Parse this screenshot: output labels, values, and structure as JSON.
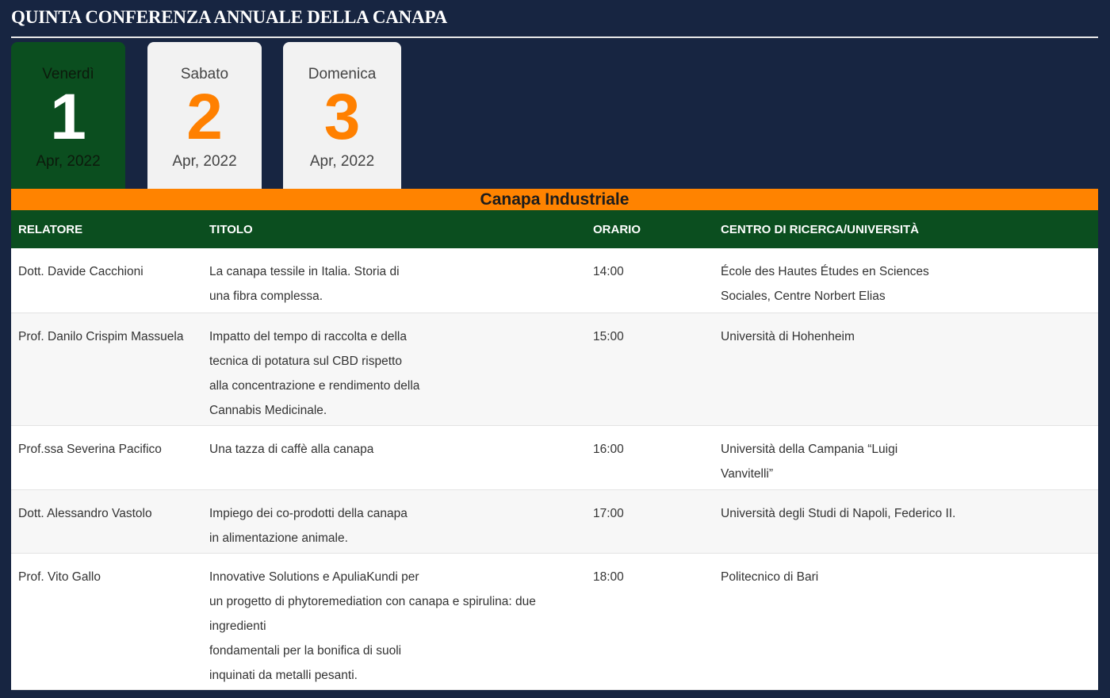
{
  "header": {
    "title": "QUINTA CONFERENZA ANNUALE DELLA CANAPA"
  },
  "days": [
    {
      "weekday": "Venerdì",
      "number": "1",
      "month": "Apr, 2022",
      "active": true
    },
    {
      "weekday": "Sabato",
      "number": "2",
      "month": "Apr, 2022",
      "active": false
    },
    {
      "weekday": "Domenica",
      "number": "3",
      "month": "Apr, 2022",
      "active": false
    }
  ],
  "track": {
    "name": "Canapa Industriale"
  },
  "table": {
    "headers": {
      "speaker": "Relatore",
      "title": "Titolo",
      "time": "Orario",
      "center": "Centro di Ricerca/Università"
    },
    "rows": [
      {
        "speaker": "Dott. Davide Cacchioni",
        "title_lines": [
          "La canapa tessile in Italia. Storia di",
          "una fibra complessa."
        ],
        "time": "14:00",
        "center": "École des Hautes Études en Sciences Sociales, Centre Norbert Elias"
      },
      {
        "speaker": "Prof. Danilo Crispim Massuela",
        "title_lines": [
          "Impatto del tempo di raccolta e della",
          "tecnica di potatura sul CBD rispetto",
          "alla concentrazione e rendimento della",
          "Cannabis Medicinale."
        ],
        "time": "15:00",
        "center": "Università di Hohenheim"
      },
      {
        "speaker": "Prof.ssa Severina Pacifico",
        "title_lines": [
          "Una tazza di caffè alla canapa"
        ],
        "time": "16:00",
        "center": "Università della Campania “Luigi Vanvitelli”"
      },
      {
        "speaker": "Dott. Alessandro Vastolo",
        "title_lines": [
          "Impiego dei co-prodotti della canapa",
          "in alimentazione animale."
        ],
        "time": "17:00",
        "center": "Università degli Studi di Napoli, Federico II."
      },
      {
        "speaker": "Prof. Vito Gallo",
        "title_lines": [
          "Innovative Solutions e ApuliaKundi per",
          "un progetto di phytoremediation con canapa e spirulina: due",
          "ingredienti",
          "fondamentali per la bonifica di suoli",
          "inquinati da metalli pesanti."
        ],
        "time": "18:00",
        "center": "Politecnico di Bari"
      }
    ]
  }
}
